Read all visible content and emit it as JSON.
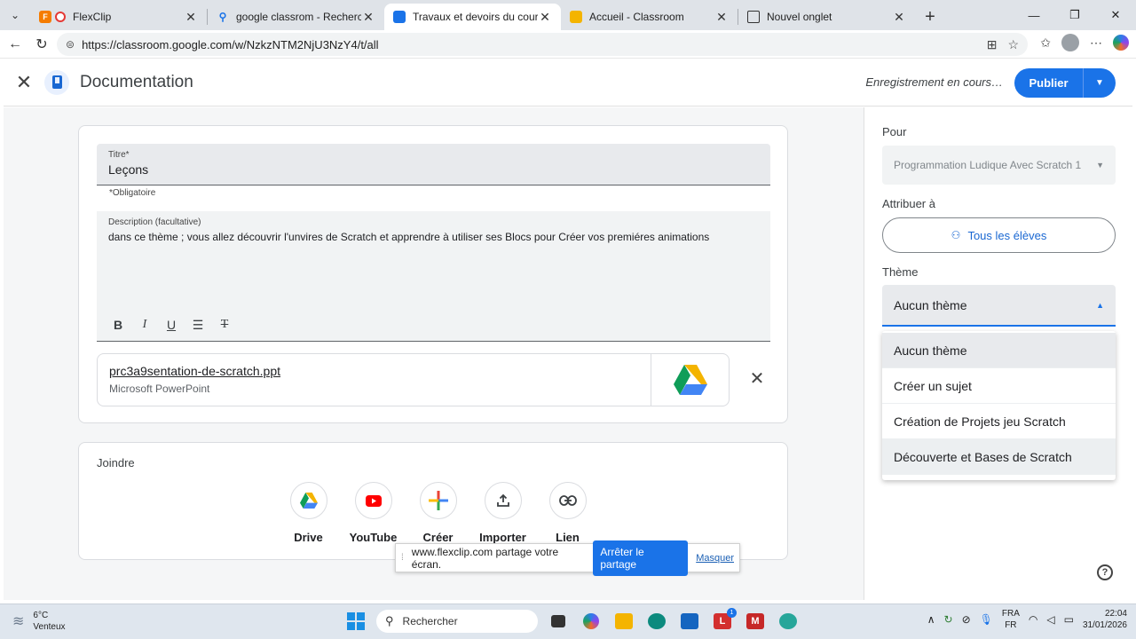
{
  "browser": {
    "tabs": [
      {
        "title": "FlexClip",
        "active": false
      },
      {
        "title": "google classrom - Recherche",
        "active": false
      },
      {
        "title": "Travaux et devoirs du cours Programmation",
        "active": true
      },
      {
        "title": "Accueil - Classroom",
        "active": false
      },
      {
        "title": "Nouvel onglet",
        "active": false
      }
    ],
    "url": "https://classroom.google.com/w/NzkzNTM2NjU3NzY4/t/all"
  },
  "header": {
    "title": "Documentation",
    "status": "Enregistrement en cours…",
    "publish_label": "Publier"
  },
  "form": {
    "title_label": "Titre*",
    "title_value": "Leçons",
    "required_note": "*Obligatoire",
    "description_label": "Description (facultative)",
    "description_value": "dans ce thème ; vous allez découvrir l'unvires de Scratch et apprendre à utiliser ses Blocs pour Créer vos premiéres animations",
    "attachment": {
      "filename": "prc3a9sentation-de-scratch.ppt",
      "type": "Microsoft PowerPoint"
    }
  },
  "attach_panel": {
    "label": "Joindre",
    "options": [
      "Drive",
      "YouTube",
      "Créer",
      "Importer",
      "Lien"
    ]
  },
  "share_banner": {
    "text": "www.flexclip.com partage votre écran.",
    "stop_label": "Arrêter le partage",
    "hide_label": "Masquer"
  },
  "sidebar": {
    "for_label": "Pour",
    "class_value": "Programmation Ludique Avec Scratch 1",
    "assign_label": "Attribuer à",
    "assign_value": "Tous les élèves",
    "theme_label": "Thème",
    "theme_value": "Aucun thème",
    "theme_options": [
      "Aucun thème",
      "Créer un sujet",
      "Création de Projets jeu Scratch",
      "Découverte et Bases de Scratch"
    ]
  },
  "taskbar": {
    "weather_temp": "6°C",
    "weather_desc": "Venteux",
    "search_placeholder": "Rechercher",
    "lang_line1": "FRA",
    "lang_line2": "FR",
    "time": "22:04",
    "date": "31/01/2026",
    "notification_count": "1"
  },
  "colors": {
    "accent": "#1a73e8",
    "drive_green": "#0f9d58",
    "drive_yellow": "#f4b400",
    "drive_blue": "#4285f4",
    "youtube_red": "#ff0000"
  }
}
